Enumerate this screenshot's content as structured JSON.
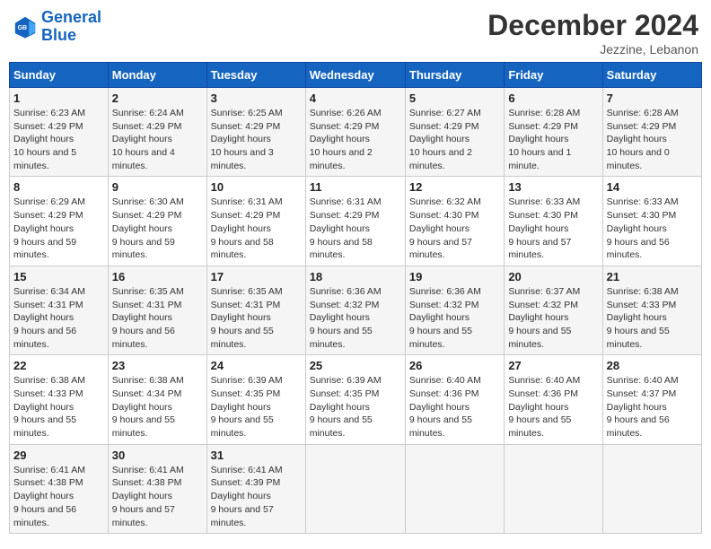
{
  "header": {
    "logo_line1": "General",
    "logo_line2": "Blue",
    "month_title": "December 2024",
    "location": "Jezzine, Lebanon"
  },
  "columns": [
    "Sunday",
    "Monday",
    "Tuesday",
    "Wednesday",
    "Thursday",
    "Friday",
    "Saturday"
  ],
  "weeks": [
    [
      {
        "day": "1",
        "sunrise": "6:23 AM",
        "sunset": "4:29 PM",
        "daylight": "10 hours and 5 minutes."
      },
      {
        "day": "2",
        "sunrise": "6:24 AM",
        "sunset": "4:29 PM",
        "daylight": "10 hours and 4 minutes."
      },
      {
        "day": "3",
        "sunrise": "6:25 AM",
        "sunset": "4:29 PM",
        "daylight": "10 hours and 3 minutes."
      },
      {
        "day": "4",
        "sunrise": "6:26 AM",
        "sunset": "4:29 PM",
        "daylight": "10 hours and 2 minutes."
      },
      {
        "day": "5",
        "sunrise": "6:27 AM",
        "sunset": "4:29 PM",
        "daylight": "10 hours and 2 minutes."
      },
      {
        "day": "6",
        "sunrise": "6:28 AM",
        "sunset": "4:29 PM",
        "daylight": "10 hours and 1 minute."
      },
      {
        "day": "7",
        "sunrise": "6:28 AM",
        "sunset": "4:29 PM",
        "daylight": "10 hours and 0 minutes."
      }
    ],
    [
      {
        "day": "8",
        "sunrise": "6:29 AM",
        "sunset": "4:29 PM",
        "daylight": "9 hours and 59 minutes."
      },
      {
        "day": "9",
        "sunrise": "6:30 AM",
        "sunset": "4:29 PM",
        "daylight": "9 hours and 59 minutes."
      },
      {
        "day": "10",
        "sunrise": "6:31 AM",
        "sunset": "4:29 PM",
        "daylight": "9 hours and 58 minutes."
      },
      {
        "day": "11",
        "sunrise": "6:31 AM",
        "sunset": "4:29 PM",
        "daylight": "9 hours and 58 minutes."
      },
      {
        "day": "12",
        "sunrise": "6:32 AM",
        "sunset": "4:30 PM",
        "daylight": "9 hours and 57 minutes."
      },
      {
        "day": "13",
        "sunrise": "6:33 AM",
        "sunset": "4:30 PM",
        "daylight": "9 hours and 57 minutes."
      },
      {
        "day": "14",
        "sunrise": "6:33 AM",
        "sunset": "4:30 PM",
        "daylight": "9 hours and 56 minutes."
      }
    ],
    [
      {
        "day": "15",
        "sunrise": "6:34 AM",
        "sunset": "4:31 PM",
        "daylight": "9 hours and 56 minutes."
      },
      {
        "day": "16",
        "sunrise": "6:35 AM",
        "sunset": "4:31 PM",
        "daylight": "9 hours and 56 minutes."
      },
      {
        "day": "17",
        "sunrise": "6:35 AM",
        "sunset": "4:31 PM",
        "daylight": "9 hours and 55 minutes."
      },
      {
        "day": "18",
        "sunrise": "6:36 AM",
        "sunset": "4:32 PM",
        "daylight": "9 hours and 55 minutes."
      },
      {
        "day": "19",
        "sunrise": "6:36 AM",
        "sunset": "4:32 PM",
        "daylight": "9 hours and 55 minutes."
      },
      {
        "day": "20",
        "sunrise": "6:37 AM",
        "sunset": "4:32 PM",
        "daylight": "9 hours and 55 minutes."
      },
      {
        "day": "21",
        "sunrise": "6:38 AM",
        "sunset": "4:33 PM",
        "daylight": "9 hours and 55 minutes."
      }
    ],
    [
      {
        "day": "22",
        "sunrise": "6:38 AM",
        "sunset": "4:33 PM",
        "daylight": "9 hours and 55 minutes."
      },
      {
        "day": "23",
        "sunrise": "6:38 AM",
        "sunset": "4:34 PM",
        "daylight": "9 hours and 55 minutes."
      },
      {
        "day": "24",
        "sunrise": "6:39 AM",
        "sunset": "4:35 PM",
        "daylight": "9 hours and 55 minutes."
      },
      {
        "day": "25",
        "sunrise": "6:39 AM",
        "sunset": "4:35 PM",
        "daylight": "9 hours and 55 minutes."
      },
      {
        "day": "26",
        "sunrise": "6:40 AM",
        "sunset": "4:36 PM",
        "daylight": "9 hours and 55 minutes."
      },
      {
        "day": "27",
        "sunrise": "6:40 AM",
        "sunset": "4:36 PM",
        "daylight": "9 hours and 55 minutes."
      },
      {
        "day": "28",
        "sunrise": "6:40 AM",
        "sunset": "4:37 PM",
        "daylight": "9 hours and 56 minutes."
      }
    ],
    [
      {
        "day": "29",
        "sunrise": "6:41 AM",
        "sunset": "4:38 PM",
        "daylight": "9 hours and 56 minutes."
      },
      {
        "day": "30",
        "sunrise": "6:41 AM",
        "sunset": "4:38 PM",
        "daylight": "9 hours and 57 minutes."
      },
      {
        "day": "31",
        "sunrise": "6:41 AM",
        "sunset": "4:39 PM",
        "daylight": "9 hours and 57 minutes."
      },
      null,
      null,
      null,
      null
    ]
  ]
}
